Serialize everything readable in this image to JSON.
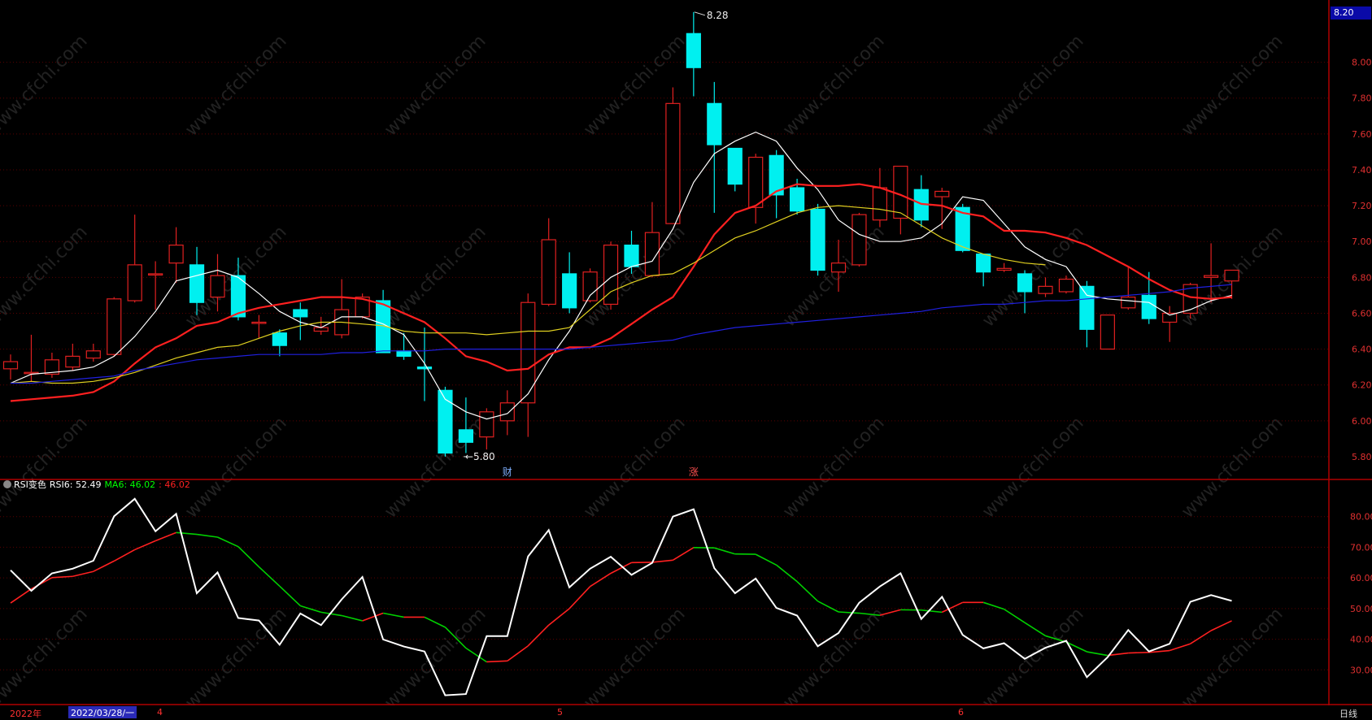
{
  "colors": {
    "up": "#e02020",
    "down": "#00f0f0",
    "ma5": "#ffffff",
    "ma10": "#ff2020",
    "ma20": "#e0d020",
    "ma60": "#2020e0",
    "rsi": "#ffffff",
    "rsi_ma_up": "#ff2020",
    "rsi_ma_down": "#00d000",
    "axis": "#b00000",
    "grid": "#5a0000",
    "label": "#e03030",
    "watermark": "#ffffff"
  },
  "watermark_text": "www.cfchi.com",
  "price_tag": "8.20",
  "indicator": {
    "name": "RSI变色",
    "rsi_label": "RSI6: 52.49",
    "ma_label": "MA6: 46.02",
    "value2": ": 46.02"
  },
  "footer": {
    "year": "2022年",
    "date": "2022/03/28/一",
    "months": [
      "4",
      "5",
      "6"
    ],
    "period": "日线"
  },
  "chart_data": [
    {
      "type": "candlestick",
      "ylim": [
        5.7,
        8.32
      ],
      "yticks": [
        "5.80",
        "6.00",
        "6.20",
        "6.40",
        "6.60",
        "6.80",
        "7.00",
        "7.20",
        "7.40",
        "7.60",
        "7.80",
        "8.00"
      ],
      "annotations": [
        {
          "text": "8.28",
          "at_index": 33,
          "value": 8.28
        },
        {
          "text": "5.80",
          "at_index": 22,
          "value": 5.8
        },
        {
          "text": "财",
          "at_index": 24
        },
        {
          "text": "涨",
          "at_index": 33
        }
      ],
      "candles": [
        {
          "o": 6.29,
          "h": 6.37,
          "l": 6.23,
          "c": 6.33
        },
        {
          "o": 6.27,
          "h": 6.48,
          "l": 6.22,
          "c": 6.27
        },
        {
          "o": 6.26,
          "h": 6.38,
          "l": 6.24,
          "c": 6.34
        },
        {
          "o": 6.3,
          "h": 6.43,
          "l": 6.28,
          "c": 6.36
        },
        {
          "o": 6.35,
          "h": 6.43,
          "l": 6.33,
          "c": 6.39
        },
        {
          "o": 6.37,
          "h": 6.69,
          "l": 6.36,
          "c": 6.68
        },
        {
          "o": 6.67,
          "h": 7.15,
          "l": 6.66,
          "c": 6.87
        },
        {
          "o": 6.82,
          "h": 6.89,
          "l": 6.62,
          "c": 6.82
        },
        {
          "o": 6.88,
          "h": 7.08,
          "l": 6.77,
          "c": 6.98
        },
        {
          "o": 6.87,
          "h": 6.97,
          "l": 6.59,
          "c": 6.66
        },
        {
          "o": 6.69,
          "h": 6.93,
          "l": 6.61,
          "c": 6.81
        },
        {
          "o": 6.81,
          "h": 6.91,
          "l": 6.56,
          "c": 6.58
        },
        {
          "o": 6.55,
          "h": 6.59,
          "l": 6.46,
          "c": 6.55
        },
        {
          "o": 6.49,
          "h": 6.51,
          "l": 6.36,
          "c": 6.42
        },
        {
          "o": 6.62,
          "h": 6.66,
          "l": 6.45,
          "c": 6.58
        },
        {
          "o": 6.5,
          "h": 6.58,
          "l": 6.48,
          "c": 6.52
        },
        {
          "o": 6.48,
          "h": 6.79,
          "l": 6.46,
          "c": 6.62
        },
        {
          "o": 6.58,
          "h": 6.71,
          "l": 6.57,
          "c": 6.69
        },
        {
          "o": 6.67,
          "h": 6.73,
          "l": 6.4,
          "c": 6.38
        },
        {
          "o": 6.39,
          "h": 6.49,
          "l": 6.34,
          "c": 6.36
        },
        {
          "o": 6.3,
          "h": 6.52,
          "l": 6.11,
          "c": 6.29
        },
        {
          "o": 6.17,
          "h": 6.19,
          "l": 5.8,
          "c": 5.82
        },
        {
          "o": 5.95,
          "h": 6.13,
          "l": 5.82,
          "c": 5.88
        },
        {
          "o": 5.91,
          "h": 6.07,
          "l": 5.84,
          "c": 6.05
        },
        {
          "o": 6.0,
          "h": 6.17,
          "l": 5.92,
          "c": 6.1
        },
        {
          "o": 6.1,
          "h": 6.71,
          "l": 5.91,
          "c": 6.66
        },
        {
          "o": 6.65,
          "h": 7.13,
          "l": 6.64,
          "c": 7.01
        },
        {
          "o": 6.82,
          "h": 6.94,
          "l": 6.6,
          "c": 6.63
        },
        {
          "o": 6.67,
          "h": 6.85,
          "l": 6.66,
          "c": 6.83
        },
        {
          "o": 6.65,
          "h": 7.0,
          "l": 6.62,
          "c": 6.98
        },
        {
          "o": 6.98,
          "h": 7.06,
          "l": 6.82,
          "c": 6.86
        },
        {
          "o": 6.81,
          "h": 7.22,
          "l": 6.8,
          "c": 7.05
        },
        {
          "o": 7.1,
          "h": 7.86,
          "l": 7.1,
          "c": 7.77
        },
        {
          "o": 8.16,
          "h": 8.28,
          "l": 7.81,
          "c": 7.97
        },
        {
          "o": 7.77,
          "h": 7.89,
          "l": 7.16,
          "c": 7.54
        },
        {
          "o": 7.52,
          "h": 7.52,
          "l": 7.28,
          "c": 7.32
        },
        {
          "o": 7.19,
          "h": 7.49,
          "l": 7.1,
          "c": 7.47
        },
        {
          "o": 7.48,
          "h": 7.51,
          "l": 7.13,
          "c": 7.26
        },
        {
          "o": 7.3,
          "h": 7.35,
          "l": 7.15,
          "c": 7.17
        },
        {
          "o": 7.18,
          "h": 7.21,
          "l": 6.81,
          "c": 6.84
        },
        {
          "o": 6.83,
          "h": 7.01,
          "l": 6.72,
          "c": 6.88
        },
        {
          "o": 6.87,
          "h": 7.16,
          "l": 6.86,
          "c": 7.15
        },
        {
          "o": 7.12,
          "h": 7.41,
          "l": 7.08,
          "c": 7.3
        },
        {
          "o": 7.13,
          "h": 7.42,
          "l": 7.04,
          "c": 7.42
        },
        {
          "o": 7.29,
          "h": 7.37,
          "l": 7.08,
          "c": 7.12
        },
        {
          "o": 7.25,
          "h": 7.3,
          "l": 7.07,
          "c": 7.28
        },
        {
          "o": 7.19,
          "h": 7.21,
          "l": 6.94,
          "c": 6.95
        },
        {
          "o": 6.93,
          "h": 6.93,
          "l": 6.75,
          "c": 6.83
        },
        {
          "o": 6.84,
          "h": 6.88,
          "l": 6.83,
          "c": 6.85
        },
        {
          "o": 6.82,
          "h": 6.84,
          "l": 6.6,
          "c": 6.72
        },
        {
          "o": 6.71,
          "h": 6.8,
          "l": 6.69,
          "c": 6.75
        },
        {
          "o": 6.72,
          "h": 6.81,
          "l": 6.71,
          "c": 6.79
        },
        {
          "o": 6.75,
          "h": 6.78,
          "l": 6.41,
          "c": 6.51
        },
        {
          "o": 6.4,
          "h": 6.58,
          "l": 6.4,
          "c": 6.59
        },
        {
          "o": 6.63,
          "h": 6.86,
          "l": 6.62,
          "c": 6.69
        },
        {
          "o": 6.7,
          "h": 6.83,
          "l": 6.54,
          "c": 6.57
        },
        {
          "o": 6.55,
          "h": 6.64,
          "l": 6.44,
          "c": 6.6
        },
        {
          "o": 6.6,
          "h": 6.77,
          "l": 6.57,
          "c": 6.76
        },
        {
          "o": 6.8,
          "h": 6.99,
          "l": 6.66,
          "c": 6.81
        },
        {
          "o": 6.78,
          "h": 6.84,
          "l": 6.68,
          "c": 6.84
        }
      ],
      "series": [
        {
          "name": "MA5",
          "values": [
            6.21,
            6.26,
            6.27,
            6.28,
            6.3,
            6.36,
            6.47,
            6.61,
            6.78,
            6.81,
            6.84,
            6.8,
            6.71,
            6.61,
            6.55,
            6.52,
            6.58,
            6.58,
            6.54,
            6.48,
            6.32,
            6.12,
            6.05,
            6.01,
            6.04,
            6.15,
            6.34,
            6.5,
            6.7,
            6.8,
            6.86,
            6.89,
            7.07,
            7.33,
            7.49,
            7.56,
            7.61,
            7.56,
            7.41,
            7.29,
            7.12,
            7.04,
            7.0,
            7.0,
            7.02,
            7.1,
            7.25,
            7.23,
            7.1,
            6.97,
            6.9,
            6.86,
            6.7,
            6.68,
            6.67,
            6.66,
            6.59,
            6.62,
            6.67,
            6.7
          ]
        },
        {
          "name": "MA10",
          "values": [
            6.11,
            6.12,
            6.13,
            6.14,
            6.16,
            6.22,
            6.32,
            6.41,
            6.46,
            6.53,
            6.55,
            6.6,
            6.63,
            6.65,
            6.67,
            6.69,
            6.69,
            6.68,
            6.65,
            6.6,
            6.55,
            6.46,
            6.36,
            6.33,
            6.28,
            6.29,
            6.37,
            6.41,
            6.41,
            6.46,
            6.54,
            6.62,
            6.69,
            6.86,
            7.04,
            7.16,
            7.2,
            7.28,
            7.32,
            7.31,
            7.31,
            7.32,
            7.3,
            7.26,
            7.21,
            7.2,
            7.16,
            7.14,
            7.06,
            7.06,
            7.05,
            7.02,
            6.98,
            6.92,
            6.86,
            6.79,
            6.73,
            6.69,
            6.68,
            6.69
          ]
        },
        {
          "name": "MA20",
          "values": [
            6.21,
            6.22,
            6.21,
            6.21,
            6.22,
            6.24,
            6.27,
            6.31,
            6.35,
            6.38,
            6.41,
            6.42,
            6.46,
            6.5,
            6.53,
            6.55,
            6.55,
            6.54,
            6.53,
            6.5,
            6.49,
            6.49,
            6.49,
            6.48,
            6.49,
            6.5,
            6.5,
            6.52,
            6.62,
            6.72,
            6.77,
            6.81,
            6.82,
            6.88,
            6.95,
            7.02,
            7.06,
            7.11,
            7.16,
            7.19,
            7.2,
            7.19,
            7.18,
            7.16,
            7.09,
            7.02,
            6.97,
            6.93,
            6.9,
            6.88,
            6.87
          ]
        },
        {
          "name": "MA60",
          "values": [
            6.21,
            6.21,
            6.22,
            6.23,
            6.24,
            6.25,
            6.28,
            6.3,
            6.32,
            6.34,
            6.35,
            6.36,
            6.37,
            6.37,
            6.37,
            6.37,
            6.38,
            6.38,
            6.39,
            6.39,
            6.39,
            6.4,
            6.4,
            6.4,
            6.4,
            6.4,
            6.4,
            6.4,
            6.41,
            6.42,
            6.43,
            6.44,
            6.45,
            6.48,
            6.5,
            6.52,
            6.53,
            6.54,
            6.55,
            6.56,
            6.57,
            6.58,
            6.59,
            6.6,
            6.61,
            6.63,
            6.64,
            6.65,
            6.65,
            6.66,
            6.67,
            6.67,
            6.68,
            6.69,
            6.7,
            6.71,
            6.72,
            6.74,
            6.75,
            6.76
          ]
        }
      ]
    },
    {
      "type": "line",
      "ylim": [
        20,
        90
      ],
      "yticks": [
        "30.00",
        "40.00",
        "50.00",
        "60.00",
        "70.00",
        "80.00"
      ],
      "series": [
        {
          "name": "RSI6",
          "values": [
            62.5,
            55.8,
            61.5,
            63.0,
            65.6,
            80.1,
            85.8,
            75.2,
            80.9,
            55.0,
            61.8,
            46.9,
            46.1,
            38.2,
            48.4,
            44.6,
            53.0,
            60.3,
            39.9,
            37.6,
            36.0,
            21.7,
            22.1,
            41.0,
            41.0,
            67.0,
            75.6,
            56.9,
            63.0,
            66.9,
            61.0,
            64.9,
            80.0,
            82.4,
            63.2,
            55.0,
            59.8,
            50.2,
            47.7,
            37.7,
            42.0,
            51.9,
            57.2,
            61.5,
            46.6,
            53.8,
            41.4,
            37.0,
            38.7,
            33.6,
            37.2,
            39.5,
            27.6,
            34.1,
            43.0,
            36.0,
            38.5,
            52.2,
            54.4,
            52.5
          ]
        },
        {
          "name": "MA6",
          "values": [
            51.8,
            56.4,
            60.1,
            60.5,
            62.1,
            65.5,
            69.2,
            72.1,
            74.8,
            74.2,
            73.3,
            70.2,
            63.6,
            57.3,
            50.9,
            48.8,
            47.7,
            46.0,
            48.5,
            47.2,
            47.2,
            43.9,
            37.1,
            32.6,
            32.9,
            37.8,
            44.6,
            50.0,
            57.2,
            61.5,
            65.0,
            65.1,
            65.8,
            69.9,
            69.8,
            67.8,
            67.7,
            64.2,
            58.8,
            52.4,
            48.9,
            48.5,
            47.8,
            49.6,
            49.5,
            48.8,
            52.0,
            52.0,
            49.8,
            45.4,
            41.1,
            39.1,
            35.9,
            34.7,
            35.5,
            35.7,
            36.3,
            38.5,
            42.8,
            46.0
          ]
        }
      ]
    }
  ]
}
